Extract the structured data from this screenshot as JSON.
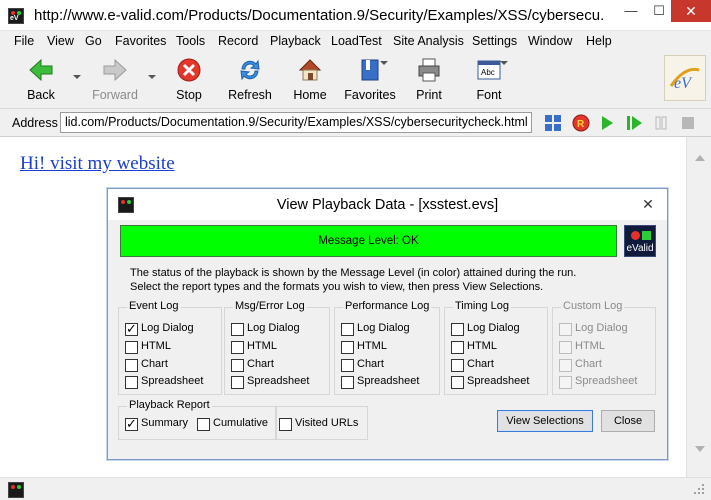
{
  "window": {
    "title": "http://www.e-valid.com/Products/Documentation.9/Security/Examples/XSS/cybersecu...",
    "app_icon": "evalid-app-icon",
    "minimize": "—",
    "maximize": "☐",
    "close": "✕"
  },
  "menu": [
    "File",
    "View",
    "Go",
    "Favorites",
    "Tools",
    "Record",
    "Playback",
    "LoadTest",
    "Site Analysis",
    "Settings",
    "Window",
    "Help"
  ],
  "toolbar": {
    "back": "Back",
    "forward": "Forward",
    "stop": "Stop",
    "refresh": "Refresh",
    "home": "Home",
    "favorites": "Favorites",
    "print": "Print",
    "font": "Font"
  },
  "address": {
    "label": "Address",
    "value": "lid.com/Products/Documentation.9/Security/Examples/XSS/cybersecuritycheck.html"
  },
  "page": {
    "link_text": "Hi! visit my website"
  },
  "dialog": {
    "title": "View Playback Data - [xsstest.evs]",
    "close": "✕",
    "message_level": "Message Level: OK",
    "message_color": "#00ff00",
    "logo_text": "eValid",
    "description_line1": "The status of the playback is shown by the Message Level (in color) attained during the run.",
    "description_line2": "Select the report types and the formats you wish to view, then press View Selections.",
    "groups": [
      {
        "title": "Event Log",
        "enabled": true,
        "options": [
          {
            "label": "Log Dialog",
            "checked": true
          },
          {
            "label": "HTML",
            "checked": false
          },
          {
            "label": "Chart",
            "checked": false
          },
          {
            "label": "Spreadsheet",
            "checked": false
          }
        ]
      },
      {
        "title": "Msg/Error Log",
        "enabled": true,
        "options": [
          {
            "label": "Log Dialog",
            "checked": false
          },
          {
            "label": "HTML",
            "checked": false
          },
          {
            "label": "Chart",
            "checked": false
          },
          {
            "label": "Spreadsheet",
            "checked": false
          }
        ]
      },
      {
        "title": "Performance Log",
        "enabled": true,
        "options": [
          {
            "label": "Log Dialog",
            "checked": false
          },
          {
            "label": "HTML",
            "checked": false
          },
          {
            "label": "Chart",
            "checked": false
          },
          {
            "label": "Spreadsheet",
            "checked": false
          }
        ]
      },
      {
        "title": "Timing Log",
        "enabled": true,
        "options": [
          {
            "label": "Log Dialog",
            "checked": false
          },
          {
            "label": "HTML",
            "checked": false
          },
          {
            "label": "Chart",
            "checked": false
          },
          {
            "label": "Spreadsheet",
            "checked": false
          }
        ]
      },
      {
        "title": "Custom Log",
        "enabled": false,
        "options": [
          {
            "label": "Log Dialog",
            "checked": false
          },
          {
            "label": "HTML",
            "checked": false
          },
          {
            "label": "Chart",
            "checked": false
          },
          {
            "label": "Spreadsheet",
            "checked": false
          }
        ]
      }
    ],
    "playback_report": {
      "title": "Playback Report",
      "summary": {
        "label": "Summary",
        "checked": true
      },
      "cumulative": {
        "label": "Cumulative",
        "checked": false
      }
    },
    "visited_urls": {
      "label": "Visited URLs",
      "checked": false
    },
    "view_selections": "View Selections",
    "close_button": "Close"
  }
}
